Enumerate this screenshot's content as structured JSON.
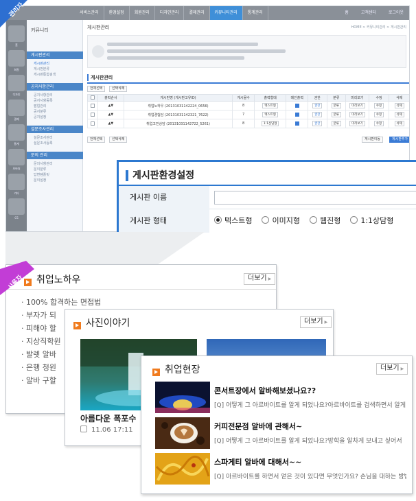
{
  "admin_tab": {
    "label": "관리자",
    "color": "#2d6fd1"
  },
  "user_tab": {
    "label": "사용자",
    "color": "#c23dd6"
  },
  "admin_panel": {
    "top_menu": [
      "서비스관리",
      "환경설정",
      "회원관리",
      "디자인관리",
      "결제관리",
      "커뮤니티관리",
      "통계관리"
    ],
    "active_menu": "커뮤니티관리",
    "top_links": [
      "홈",
      "고객센터",
      "로그아웃"
    ],
    "side_icon_labels": [
      "홈",
      "회원",
      "디자인",
      "결제",
      "통계",
      "모바일",
      "기타",
      "CS",
      "SMS"
    ],
    "side_nav": {
      "title": "커뮤니티",
      "sections": [
        {
          "title": "게시판관리",
          "items": [
            "게시판관리",
            "게시판분류",
            "게시판통합검색"
          ]
        },
        {
          "title": "공지사항관리",
          "items": [
            "공지사항관리",
            "공지사항등록",
            "팝업관리",
            "공지분류",
            "공지설정"
          ]
        },
        {
          "title": "설문조사관리",
          "items": [
            "설문조사관리",
            "설문조사등록"
          ]
        },
        {
          "title": "문의 관리",
          "items": [
            "문의사항관리",
            "문의분류",
            "답변템플릿",
            "문의설정"
          ]
        }
      ]
    },
    "page_title": "게시판관리",
    "breadcrumb": "HOME > 커뮤니티관리 > 게시판관리",
    "board_title": "게시판관리",
    "buttons": {
      "select_all": "전체선택",
      "delete_selected": "선택삭제",
      "board_move": "게시판이동",
      "add_board": "게시판추가"
    },
    "table": {
      "headers": [
        "",
        "출력순서",
        "게시판명 (게시판고유ID)",
        "게시물수",
        "출력형태",
        "메인출력",
        "권한",
        "분류",
        "미리보기",
        "수정",
        "삭제"
      ],
      "rows": [
        {
          "order": "▲▼",
          "name": "취업노하우 (20131031142224_0656)",
          "count": "8",
          "type": "텍스트형",
          "main": true,
          "perm": "권한",
          "cat": "분류",
          "preview": "미리보기",
          "edit": "수정",
          "del": "삭제"
        },
        {
          "order": "▲▼",
          "name": "취업경험담 (20131031142321_7622)",
          "count": "7",
          "type": "텍스트형",
          "main": true,
          "perm": "권한",
          "cat": "분류",
          "preview": "미리보기",
          "edit": "수정",
          "del": "삭제"
        },
        {
          "order": "▲▼",
          "name": "취업고민상담 (20131031142722_5261)",
          "count": "8",
          "type": "1:1상담형",
          "main": true,
          "perm": "권한",
          "cat": "분류",
          "preview": "미리보기",
          "edit": "수정",
          "del": "삭제"
        }
      ]
    }
  },
  "settings": {
    "title": "게시판환경설정",
    "name_label": "게시판 이름",
    "name_value": "",
    "type_label": "게시판 형태",
    "type_options": [
      "텍스트형",
      "이미지형",
      "웹진형",
      "1:1상담형"
    ],
    "type_selected": "텍스트형"
  },
  "card_knowhow": {
    "title": "취업노하우",
    "more": "더보기",
    "items": [
      "100% 합격하는 면접법",
      "부자가 되",
      "피해야 할",
      "지상직학원",
      "발렛 알바",
      "은행 청원",
      "알바 구할"
    ]
  },
  "card_photo": {
    "title": "사진이야기",
    "more": "더보기",
    "photo_caption": "아름다운 폭포수",
    "photo_date": "11.06 17:11"
  },
  "card_field": {
    "title": "취업현장",
    "more": "더보기",
    "items": [
      {
        "title": "콘서트장에서 알바해보셨나요??",
        "desc": "[Q] 어떻게 그 아르바이트를 알게 되었나요?아르바이트를 검색하면서 알게 되었어요"
      },
      {
        "title": "커피전문점 알바에 관해서~",
        "desc": "[Q] 어떻게 그 아르바이트를 알게 되었나요?방학을 알차게 보내고 싶어서"
      },
      {
        "title": "스파게티 알바에 대해서~~",
        "desc": "[Q] 아르바이트를 하면서 얻은 것이 있다면 무엇인가요? 손님을 대하는 방법"
      }
    ]
  }
}
